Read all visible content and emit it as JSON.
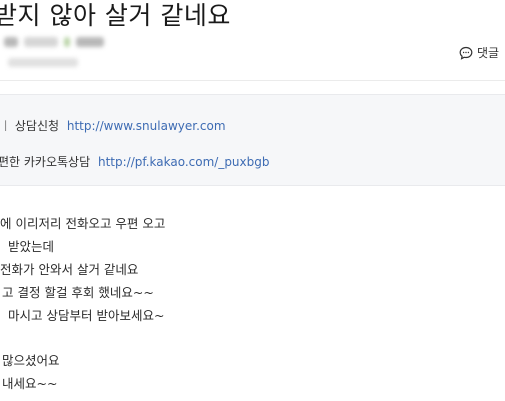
{
  "post": {
    "title": "받지 않아 살거 같네요"
  },
  "actions": {
    "comment_label": "댓글",
    "comment_icon": "chat-bubble-icon"
  },
  "contact": {
    "row1_label": "상담신청",
    "row1_link": "http://www.snulawyer.com",
    "row2_label": "편한 카카오톡상담",
    "row2_link": "http://pf.kakao.com/_puxbgb"
  },
  "body_lines": [
    "에  이리저리 전화오고 우편 오고",
    "받았는데",
    "전화가 안와서 살거 같네요",
    "고 결정 할걸 후회 했네요~~",
    "마시고 상담부터 받아보세요~",
    "",
    "많으셨어요",
    "내세요~~"
  ]
}
